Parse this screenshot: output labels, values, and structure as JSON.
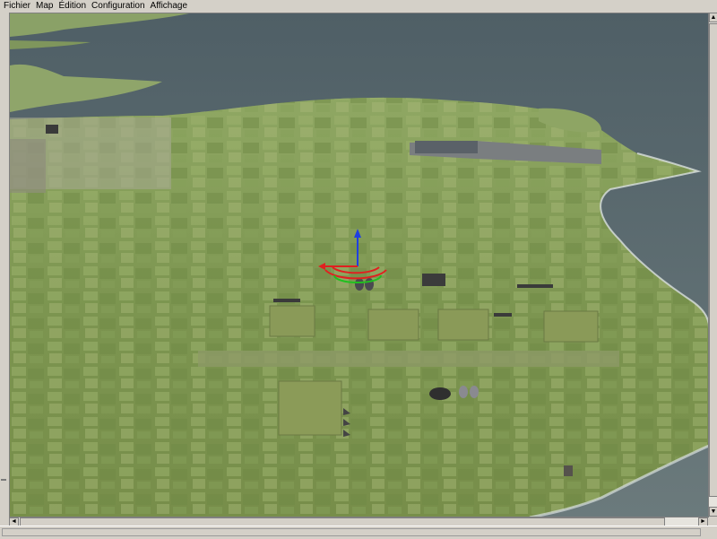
{
  "menu": {
    "items": [
      "Fichier",
      "Map",
      "Édition",
      "Configuration",
      "Affichage"
    ]
  },
  "scrollbar": {
    "up_arrow": "▲",
    "down_arrow": "▼",
    "left_arrow": "◄",
    "right_arrow": "►"
  },
  "colors": {
    "sea": "#5b6b70",
    "land": "#7f9a55",
    "gizmo_x": "#e02020",
    "gizmo_y": "#20c020",
    "gizmo_z": "#2040e0"
  }
}
